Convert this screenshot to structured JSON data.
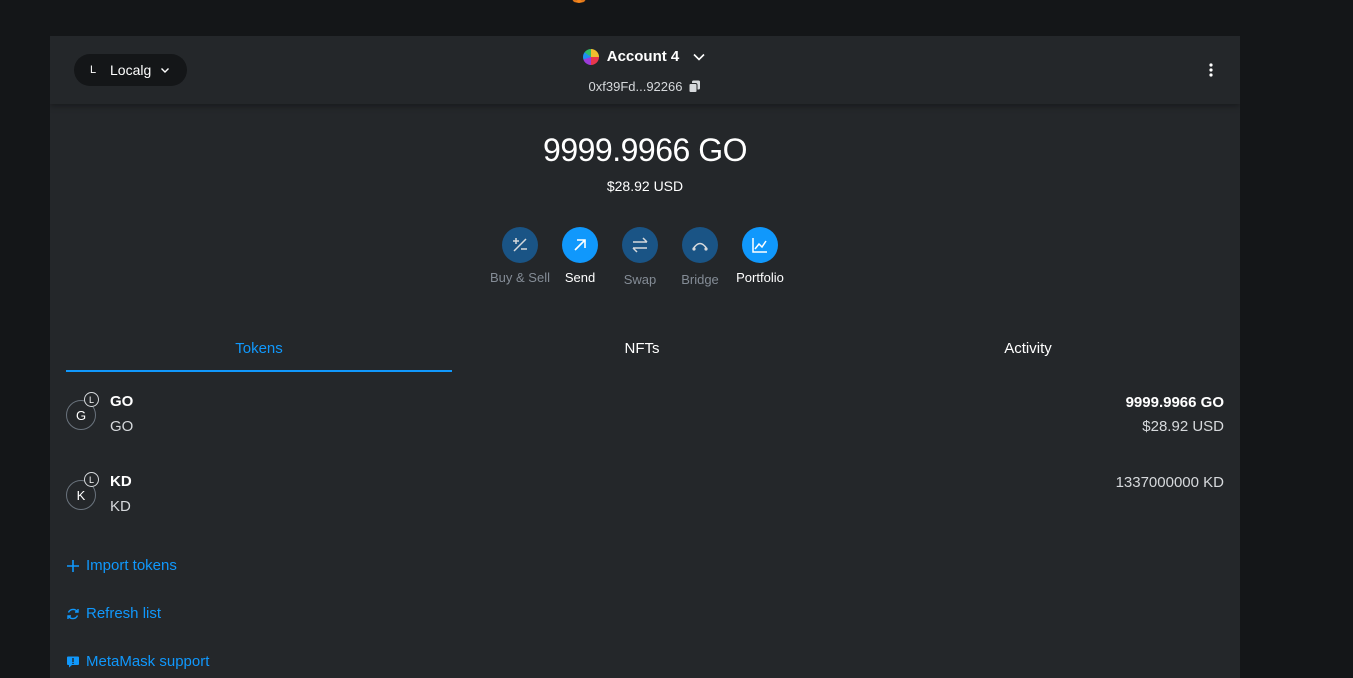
{
  "header": {
    "network": {
      "avatar_letter": "L",
      "name": "Localg"
    },
    "account": {
      "name": "Account 4",
      "address": "0xf39Fd...92266"
    }
  },
  "balance": {
    "primary": "9999.9966 GO",
    "fiat": "$28.92 USD"
  },
  "actions": [
    {
      "label": "Buy & Sell",
      "icon": "buy-sell-icon"
    },
    {
      "label": "Send",
      "icon": "send-arrow-icon"
    },
    {
      "label": "Swap",
      "icon": "swap-icon"
    },
    {
      "label": "Bridge",
      "icon": "bridge-icon"
    },
    {
      "label": "Portfolio",
      "icon": "chart-icon"
    }
  ],
  "tabs": [
    {
      "label": "Tokens",
      "active": true
    },
    {
      "label": "NFTs",
      "active": false
    },
    {
      "label": "Activity",
      "active": false
    }
  ],
  "tokens": [
    {
      "letter": "G",
      "network_letter": "L",
      "symbol": "GO",
      "name": "GO",
      "balance": "9999.9966 GO",
      "fiat": "$28.92 USD"
    },
    {
      "letter": "K",
      "network_letter": "L",
      "symbol": "KD",
      "name": "KD",
      "balance": "1337000000 KD",
      "fiat": ""
    }
  ],
  "links": {
    "import_tokens": "Import tokens",
    "refresh_list": "Refresh list",
    "support": "MetaMask support"
  },
  "colors": {
    "accent": "#1098fc",
    "background": "#24272a",
    "page_background": "#141618",
    "action_dim": "#1a5485"
  }
}
